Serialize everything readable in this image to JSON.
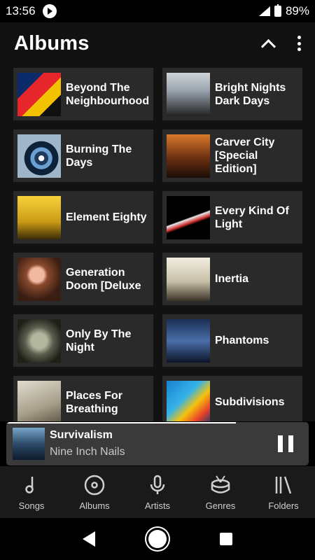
{
  "status": {
    "time": "13:56",
    "battery": "89%"
  },
  "appbar": {
    "title": "Albums"
  },
  "albums": [
    {
      "label": "Beyond The Neighbourhood"
    },
    {
      "label": "Bright Nights Dark Days"
    },
    {
      "label": "Burning The Days"
    },
    {
      "label": "Carver City [Special Edition]"
    },
    {
      "label": "Element Eighty"
    },
    {
      "label": "Every Kind Of Light"
    },
    {
      "label": "Generation Doom [Deluxe"
    },
    {
      "label": "Inertia"
    },
    {
      "label": "Only By The Night"
    },
    {
      "label": "Phantoms"
    },
    {
      "label": "Places For Breathing"
    },
    {
      "label": "Subdivisions"
    }
  ],
  "now_playing": {
    "title": "Survivalism",
    "artist": "Nine Inch Nails",
    "progress": 0.76
  },
  "bottom_nav": {
    "songs": "Songs",
    "albums": "Albums",
    "artists": "Artists",
    "genres": "Genres",
    "folders": "Folders"
  },
  "colors": {
    "background": "#121212",
    "card": "#2a2a2a",
    "now_playing_bg": "#3a3a3a"
  }
}
